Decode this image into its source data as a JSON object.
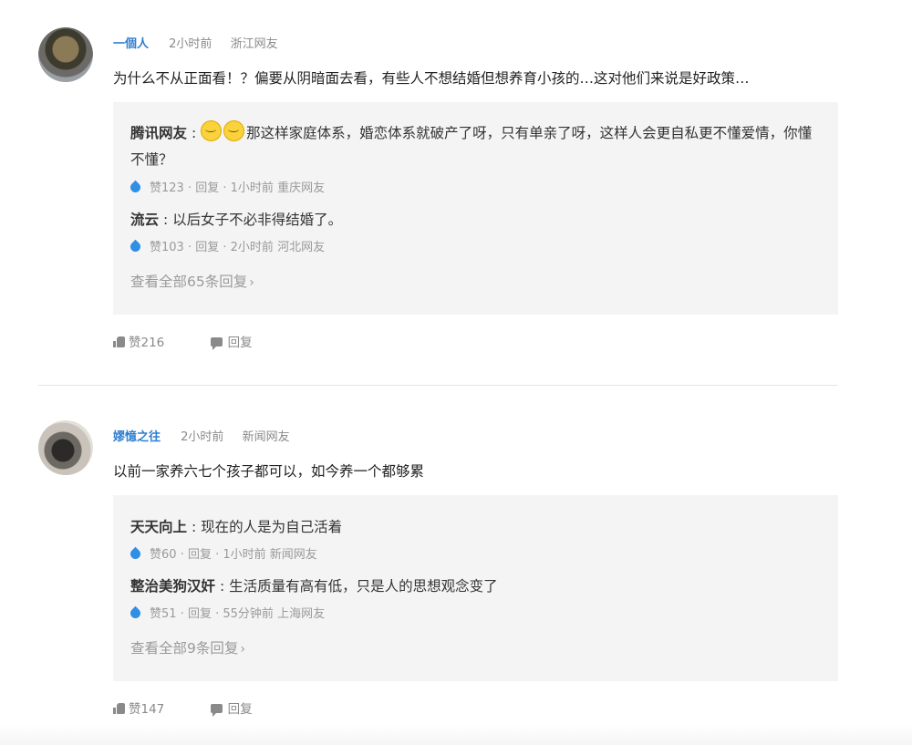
{
  "comments": [
    {
      "author": "一個人",
      "time": "2小时前",
      "location": "浙江网友",
      "text": "为什么不从正面看！？偏要从阴暗面去看，有些人不想结婚但想养育小孩的…这对他们来说是好政策…",
      "replies": [
        {
          "name": "腾讯网友",
          "text": "那这样家庭体系，婚恋体系就破产了呀，只有单亲了呀，这样人会更自私更不懂爱情，你懂不懂？",
          "likes": "赞123",
          "reply_label": "回复",
          "time": "1小时前",
          "location": "重庆网友"
        },
        {
          "name": "流云",
          "text": "以后女子不必非得结婚了。",
          "likes": "赞103",
          "reply_label": "回复",
          "time": "2小时前",
          "location": "河北网友"
        }
      ],
      "more_label": "查看全部65条回复",
      "likes": "赞216",
      "reply_label": "回复"
    },
    {
      "author": "嫪憶之往",
      "time": "2小时前",
      "location": "新闻网友",
      "text": "以前一家养六七个孩子都可以，如今养一个都够累",
      "replies": [
        {
          "name": "天天向上",
          "text": "现在的人是为自己活着",
          "likes": "赞60",
          "reply_label": "回复",
          "time": "1小时前",
          "location": "新闻网友"
        },
        {
          "name": "整治美狗汉奸",
          "text": "生活质量有高有低，只是人的思想观念变了",
          "likes": "赞51",
          "reply_label": "回复",
          "time": "55分钟前",
          "location": "上海网友"
        }
      ],
      "more_label": "查看全部9条回复",
      "likes": "赞147",
      "reply_label": "回复"
    }
  ],
  "icons": {
    "like_reply": "water-drop-icon",
    "thumb": "thumbs-up-icon",
    "comment": "comment-bubble-icon",
    "emoji": "smiley-emoji-icon",
    "chevron": "chevron-right-icon"
  },
  "colors": {
    "author": "#2f7fd0",
    "drop": "#2f8ee6",
    "reply_bg": "#f4f4f4"
  },
  "symbols": {
    "sep": " : ",
    "dot": " · ",
    "chevron": "›"
  }
}
